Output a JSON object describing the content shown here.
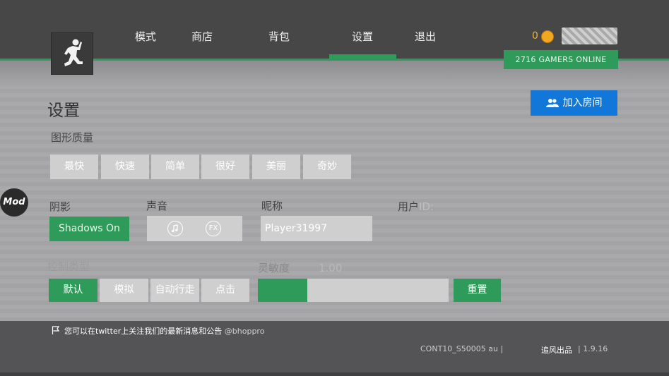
{
  "nav": {
    "items": [
      "模式",
      "商店",
      "背包",
      "设置",
      "退出"
    ],
    "active": "设置"
  },
  "header": {
    "coins": "0",
    "gamers_online": "2716 GAMERS ONLINE",
    "join_room": "加入房间"
  },
  "settings": {
    "title": "设置",
    "graphics_label": "图形质量",
    "graphics_options": [
      "最快",
      "快速",
      "简单",
      "很好",
      "美丽",
      "奇妙"
    ],
    "shadow_label": "阴影",
    "shadow_value": "Shadows On",
    "sound_label": "声音",
    "sound_icons": [
      "music-note-icon",
      "fx-icon"
    ],
    "fx_text": "FX",
    "nickname_label": "昵称",
    "nickname_value": "Player31997",
    "user_id_label": "用户",
    "user_id_suffix": "ID:",
    "control_label": "控制类型",
    "control_options": [
      "默认",
      "模拟",
      "自动行走",
      "点击"
    ],
    "control_active": "默认",
    "sensitivity_label": "灵敏度",
    "sensitivity_value": "1.00",
    "sensitivity_fill": 0.26,
    "reset_label": "重置"
  },
  "mod_badge": "Mod",
  "footer": {
    "twitter_text": "您可以在twitter上关注我们的最新消息和公告",
    "twitter_handle": "@bhoppro",
    "server": "CONT10_S50005 au",
    "credit": "追风出品",
    "version": "1.9.16"
  },
  "colors": {
    "accent_green": "#2e9b5a",
    "join_blue": "#1177d8",
    "coin_gold": "#e8b53a"
  }
}
